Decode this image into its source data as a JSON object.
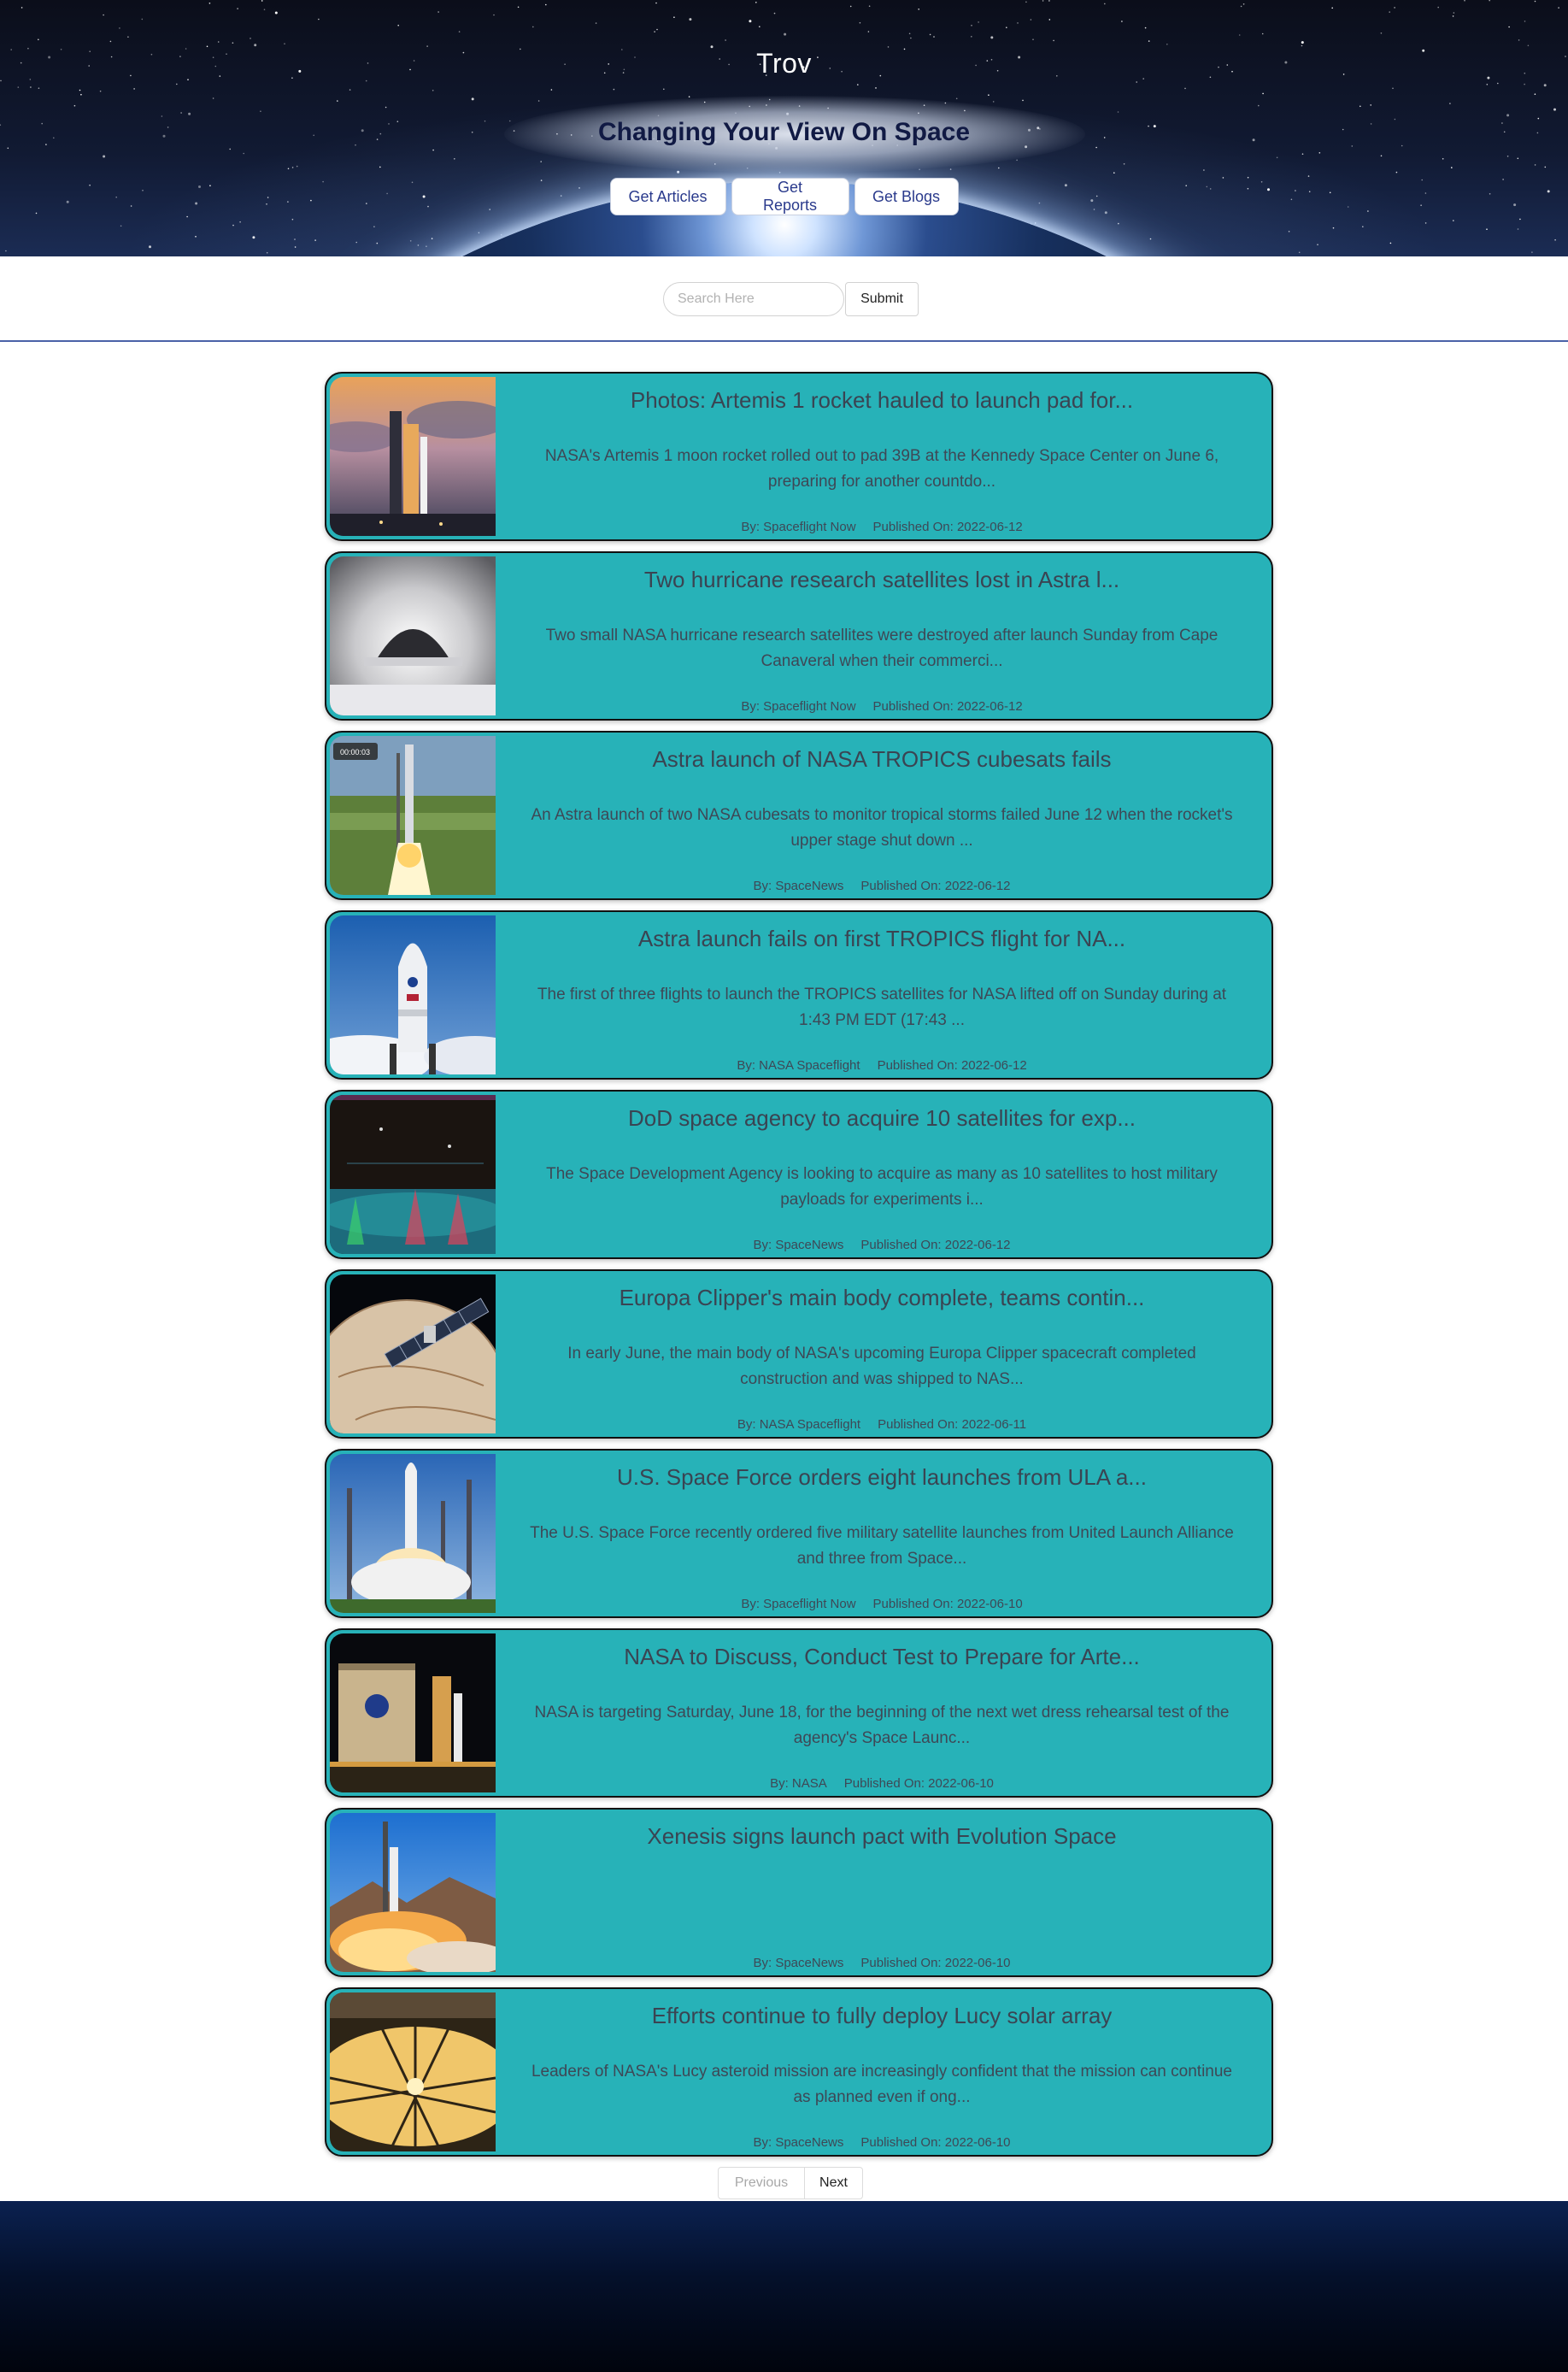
{
  "hero": {
    "title": "Trov",
    "tagline": "Changing Your View On Space",
    "nav": [
      "Get Articles",
      "Get Reports",
      "Get Blogs"
    ]
  },
  "search": {
    "placeholder": "Search Here",
    "submit_label": "Submit"
  },
  "articles": [
    {
      "title": "Photos: Artemis 1 rocket hauled to launch pad for...",
      "description": "NASA's Artemis 1 moon rocket rolled out to pad 39B at the Kennedy Space Center on June 6, preparing for another countdo...",
      "by": "By: Spaceflight Now",
      "published": "Published On: 2022-06-12",
      "image": "artemis-rocket-on-pad"
    },
    {
      "title": "Two hurricane research satellites lost in Astra l...",
      "description": "Two small NASA hurricane research satellites were destroyed after launch Sunday from Cape Canaveral when their commerci...",
      "by": "By: Spaceflight Now",
      "published": "Published On: 2022-06-12",
      "image": "rocket-engine-nozzle"
    },
    {
      "title": "Astra launch of NASA TROPICS cubesats fails",
      "description": "An Astra launch of two NASA cubesats to monitor tropical storms failed June 12 when the rocket's upper stage shut down ...",
      "by": "By: SpaceNews",
      "published": "Published On: 2022-06-12",
      "image": "astra-liftoff",
      "overlay": "00:00:03"
    },
    {
      "title": "Astra launch fails on first TROPICS flight for NA...",
      "description": "The first of three flights to launch the TROPICS satellites for NASA lifted off on Sunday during at 1:43 PM EDT (17:43 ...",
      "by": "By: NASA Spaceflight",
      "published": "Published On: 2022-06-12",
      "image": "rocket-fairing-sky"
    },
    {
      "title": "DoD space agency to acquire 10 satellites for exp...",
      "description": "The Space Development Agency is looking to acquire as many as 10 satellites to host military payloads for experiments i...",
      "by": "By: SpaceNews",
      "published": "Published On: 2022-06-12",
      "image": "satellite-network-diagram"
    },
    {
      "title": "Europa Clipper's main body complete, teams contin...",
      "description": "In early June, the main body of NASA's upcoming Europa Clipper spacecraft completed construction and was shipped to NAS...",
      "by": "By: NASA Spaceflight",
      "published": "Published On: 2022-06-11",
      "image": "europa-clipper-spacecraft"
    },
    {
      "title": "U.S. Space Force orders eight launches from ULA a...",
      "description": "The U.S. Space Force recently ordered five military satellite launches from United Launch Alliance and three from Space...",
      "by": "By: Spaceflight Now",
      "published": "Published On: 2022-06-10",
      "image": "ula-launch"
    },
    {
      "title": "NASA to Discuss, Conduct Test to Prepare for Arte...",
      "description": "NASA is targeting Saturday, June 18, for the beginning of the next wet dress rehearsal test of the agency's Space Launc...",
      "by": "By: NASA",
      "published": "Published On: 2022-06-10",
      "image": "vab-night"
    },
    {
      "title": "Xenesis signs launch pact with Evolution Space",
      "description": "",
      "by": "By: SpaceNews",
      "published": "Published On: 2022-06-10",
      "image": "desert-launch"
    },
    {
      "title": "Efforts continue to fully deploy Lucy solar array",
      "description": "Leaders of NASA's Lucy asteroid mission are increasingly confident that the mission can continue as planned even if ong...",
      "by": "By: SpaceNews",
      "published": "Published On: 2022-06-10",
      "image": "lucy-solar-array"
    }
  ],
  "pagination": {
    "previous": "Previous",
    "next": "Next"
  }
}
